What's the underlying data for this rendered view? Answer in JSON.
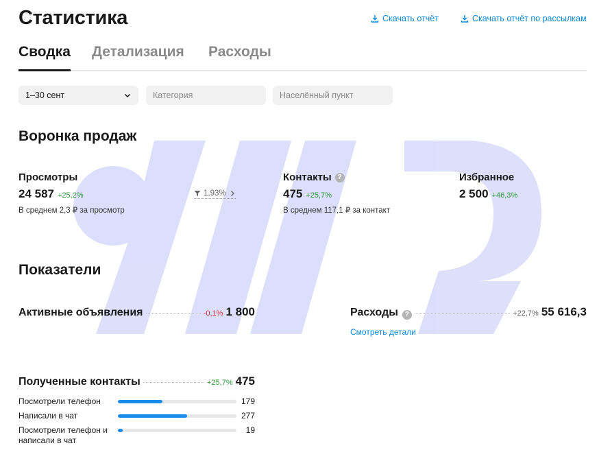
{
  "header": {
    "title": "Статистика",
    "download_report": "Скачать отчёт",
    "download_mailing_report": "Скачать отчёт по рассылкам"
  },
  "tabs": [
    {
      "label": "Сводка",
      "active": true
    },
    {
      "label": "Детализация",
      "active": false
    },
    {
      "label": "Расходы",
      "active": false
    }
  ],
  "filters": {
    "period": "1–30 сент",
    "category_placeholder": "Категория",
    "city_placeholder": "Населённый пункт"
  },
  "funnel": {
    "title": "Воронка продаж",
    "views": {
      "label": "Просмотры",
      "value": "24 587",
      "delta": "+25,2%",
      "sub": "В среднем 2,3 ₽ за просмотр"
    },
    "conversion": "1,93%",
    "contacts": {
      "label": "Контакты",
      "value": "475",
      "delta": "+25,7%",
      "sub": "В среднем 117,1 ₽ за контакт"
    },
    "favorites": {
      "label": "Избранное",
      "value": "2 500",
      "delta": "+46,3%"
    }
  },
  "indicators": {
    "title": "Показатели",
    "active_ads": {
      "label": "Активные объявления",
      "delta": "-0,1%",
      "value": "1 800"
    },
    "expenses": {
      "label": "Расходы",
      "delta": "+22,7%",
      "value": "55 616,3",
      "details_link": "Смотреть детали"
    },
    "received_contacts": {
      "label": "Полученные контакты",
      "delta": "+25,7%",
      "value": "475"
    },
    "breakdown": [
      {
        "label": "Посмотрели телефон",
        "value": "179",
        "fraction": 0.377
      },
      {
        "label": "Написали в чат",
        "value": "277",
        "fraction": 0.583
      },
      {
        "label": "Посмотрели телефон и написали в чат",
        "value": "19",
        "fraction": 0.04
      }
    ]
  },
  "colors": {
    "accent": "#0a88e0",
    "positive": "#2a9a3a",
    "negative": "#e0343c",
    "bar": "#1a8cec",
    "watermark": "#d9dcfb"
  }
}
